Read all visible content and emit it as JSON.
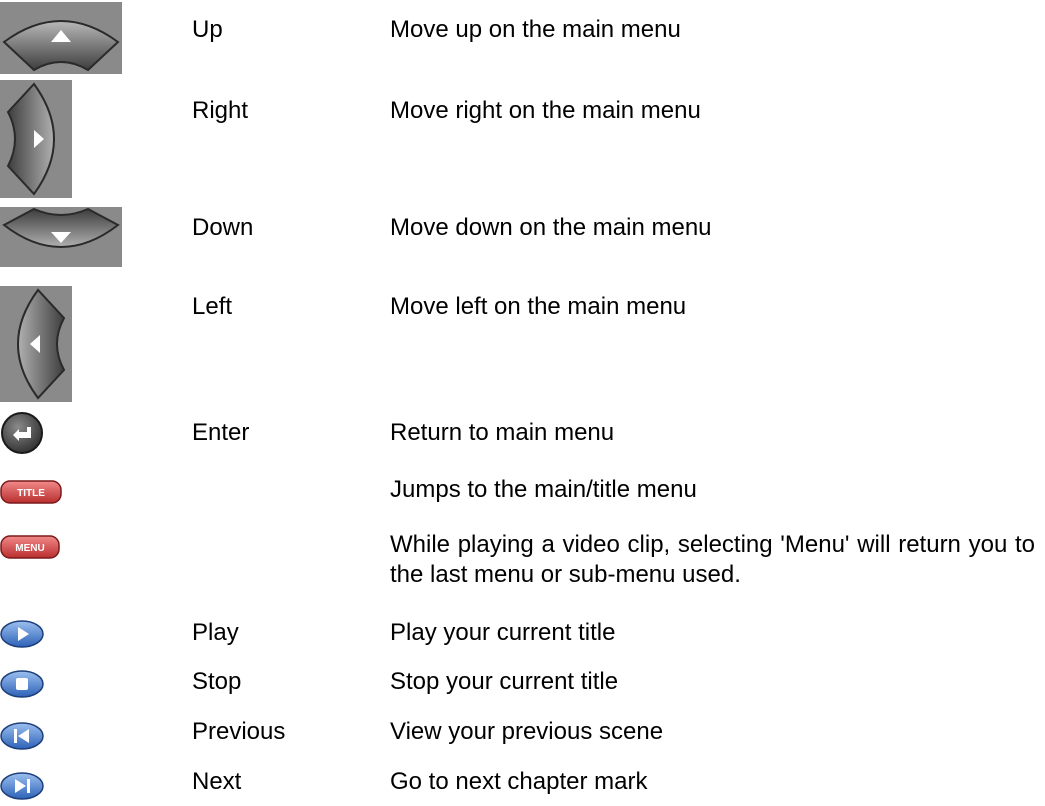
{
  "rows": [
    {
      "icon": "arrow-up-icon",
      "name": "Up",
      "description": "Move up on the main menu"
    },
    {
      "icon": "arrow-right-icon",
      "name": "Right",
      "description": "Move right on the main menu"
    },
    {
      "icon": "arrow-down-icon",
      "name": "Down",
      "description": "Move down on the main menu"
    },
    {
      "icon": "arrow-left-icon",
      "name": "Left",
      "description": "Move left on the main menu"
    },
    {
      "icon": "enter-icon",
      "name": "Enter",
      "description": "Return to main menu"
    },
    {
      "icon": "title-button-icon",
      "icon_label": "TITLE",
      "name": "",
      "description": "Jumps to the main/title menu"
    },
    {
      "icon": "menu-button-icon",
      "icon_label": "MENU",
      "name": "",
      "description": "While playing a video clip, selecting 'Menu' will return you to the last menu or sub-menu used."
    },
    {
      "icon": "play-icon",
      "name": "Play",
      "description": "Play your current title"
    },
    {
      "icon": "stop-icon",
      "name": "Stop",
      "description": "Stop your current title"
    },
    {
      "icon": "previous-icon",
      "name": "Previous",
      "description": "View your previous scene"
    },
    {
      "icon": "next-icon",
      "name": "Next",
      "description": "Go to next chapter mark"
    }
  ],
  "colors": {
    "text": "#000000",
    "dpad": "#5a5a5a",
    "red_button": "#d84a4a",
    "blue_button": "#4a7fd0"
  }
}
